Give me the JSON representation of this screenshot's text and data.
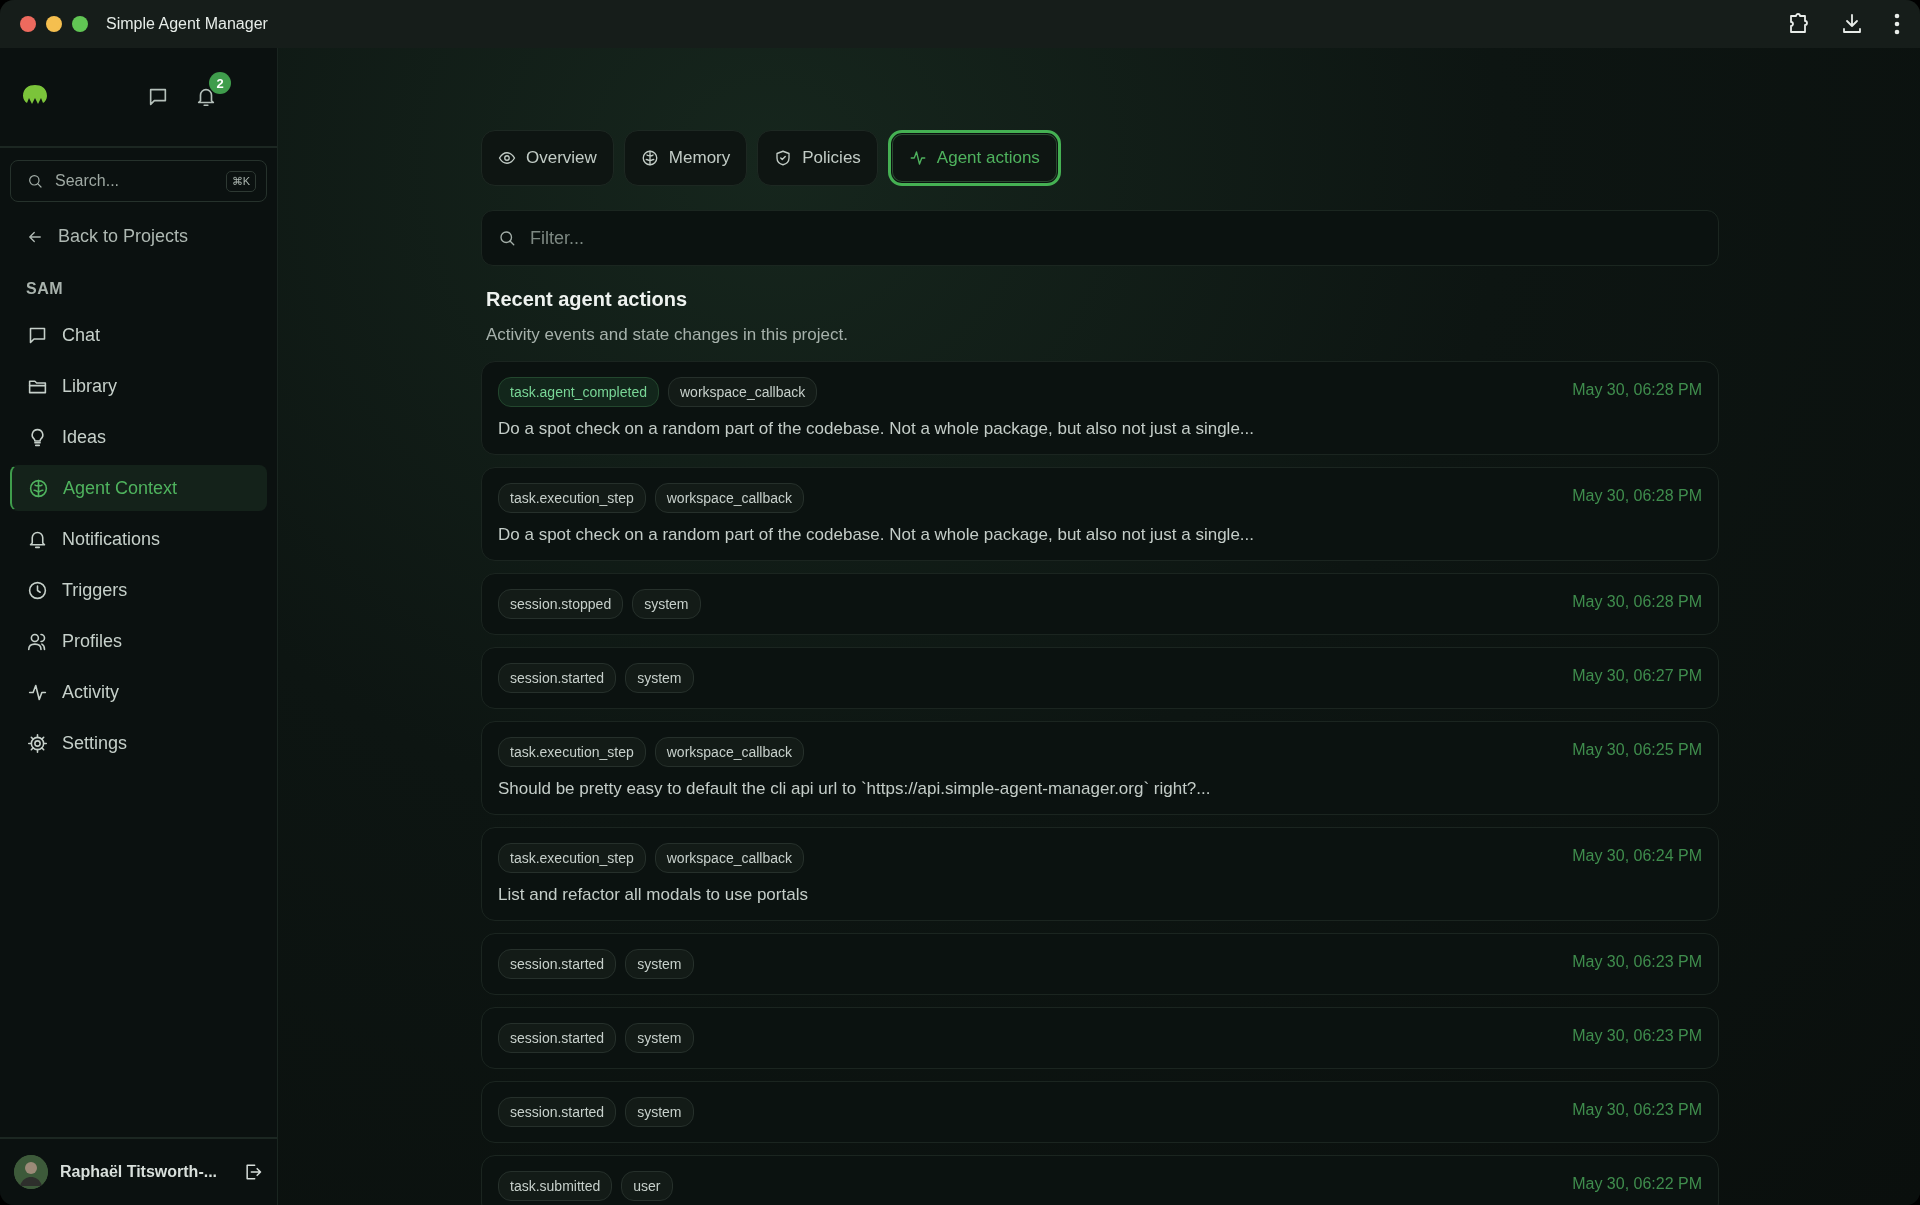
{
  "window": {
    "title": "Simple Agent Manager"
  },
  "sidebar": {
    "notification_count": "2",
    "search": {
      "placeholder": "Search...",
      "shortcut": "⌘K"
    },
    "back_link": "Back to Projects",
    "section": "SAM",
    "items": [
      {
        "label": "Chat",
        "selected": false
      },
      {
        "label": "Library",
        "selected": false
      },
      {
        "label": "Ideas",
        "selected": false
      },
      {
        "label": "Agent Context",
        "selected": true
      },
      {
        "label": "Notifications",
        "selected": false
      },
      {
        "label": "Triggers",
        "selected": false
      },
      {
        "label": "Profiles",
        "selected": false
      },
      {
        "label": "Activity",
        "selected": false
      },
      {
        "label": "Settings",
        "selected": false
      }
    ],
    "user": {
      "name": "Raphaël Titsworth-..."
    }
  },
  "tabs": [
    {
      "label": "Overview",
      "selected": false
    },
    {
      "label": "Memory",
      "selected": false
    },
    {
      "label": "Policies",
      "selected": false
    },
    {
      "label": "Agent actions",
      "selected": true
    }
  ],
  "filter": {
    "placeholder": "Filter..."
  },
  "section": {
    "title": "Recent agent actions",
    "subtitle": "Activity events and state changes in this project."
  },
  "events": [
    {
      "tags": [
        {
          "text": "task.agent_completed",
          "kind": "success"
        },
        {
          "text": "workspace_callback",
          "kind": "neutral"
        }
      ],
      "time": "May 30, 06:28 PM",
      "message": "Do a spot check on a random part of the codebase. Not a whole package, but also not just a single..."
    },
    {
      "tags": [
        {
          "text": "task.execution_step",
          "kind": "neutral"
        },
        {
          "text": "workspace_callback",
          "kind": "neutral"
        }
      ],
      "time": "May 30, 06:28 PM",
      "message": "Do a spot check on a random part of the codebase. Not a whole package, but also not just a single..."
    },
    {
      "tags": [
        {
          "text": "session.stopped",
          "kind": "neutral"
        },
        {
          "text": "system",
          "kind": "neutral"
        }
      ],
      "time": "May 30, 06:28 PM"
    },
    {
      "tags": [
        {
          "text": "session.started",
          "kind": "neutral"
        },
        {
          "text": "system",
          "kind": "neutral"
        }
      ],
      "time": "May 30, 06:27 PM"
    },
    {
      "tags": [
        {
          "text": "task.execution_step",
          "kind": "neutral"
        },
        {
          "text": "workspace_callback",
          "kind": "neutral"
        }
      ],
      "time": "May 30, 06:25 PM",
      "message": "Should be pretty easy to default the cli api url to `https://api.simple-agent-manager.org` right?..."
    },
    {
      "tags": [
        {
          "text": "task.execution_step",
          "kind": "neutral"
        },
        {
          "text": "workspace_callback",
          "kind": "neutral"
        }
      ],
      "time": "May 30, 06:24 PM",
      "message": "List and refactor all modals to use portals"
    },
    {
      "tags": [
        {
          "text": "session.started",
          "kind": "neutral"
        },
        {
          "text": "system",
          "kind": "neutral"
        }
      ],
      "time": "May 30, 06:23 PM"
    },
    {
      "tags": [
        {
          "text": "session.started",
          "kind": "neutral"
        },
        {
          "text": "system",
          "kind": "neutral"
        }
      ],
      "time": "May 30, 06:23 PM"
    },
    {
      "tags": [
        {
          "text": "session.started",
          "kind": "neutral"
        },
        {
          "text": "system",
          "kind": "neutral"
        }
      ],
      "time": "May 30, 06:23 PM"
    },
    {
      "tags": [
        {
          "text": "task.submitted",
          "kind": "neutral"
        },
        {
          "text": "user",
          "kind": "neutral"
        }
      ],
      "time": "May 30, 06:22 PM"
    }
  ]
}
